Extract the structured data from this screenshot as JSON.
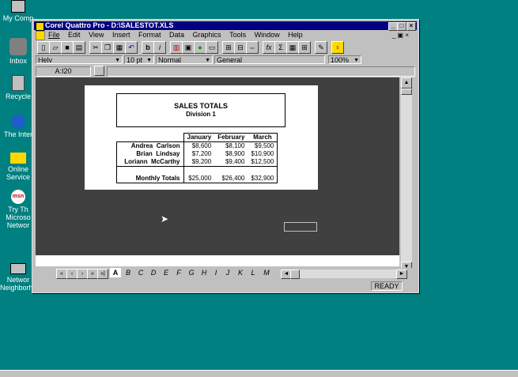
{
  "desktop": {
    "icons": [
      {
        "label": "My Comp"
      },
      {
        "label": "Inbox"
      },
      {
        "label": "Recycle"
      },
      {
        "label": "The Inter"
      },
      {
        "label": "Online Service"
      },
      {
        "label": "Try Th Microso Networ"
      },
      {
        "label": "Networ Neighborhood"
      }
    ]
  },
  "window": {
    "title": "Corel Quattro Pro - D:\\SALESTOT.XLS",
    "menu": [
      "File",
      "Edit",
      "View",
      "Insert",
      "Format",
      "Data",
      "Graphics",
      "Tools",
      "Window",
      "Help"
    ],
    "font": "Helv",
    "size": "10 pt",
    "style": "Normal",
    "number_format": "General",
    "zoom": "100%",
    "cell_ref": "A:I20",
    "status": "READY"
  },
  "report": {
    "title": "SALES TOTALS",
    "subtitle": "Division 1",
    "headers": [
      "January",
      "February",
      "March"
    ],
    "rows": [
      {
        "first": "Andrea",
        "last": "Carlson",
        "values": [
          "$8,600",
          "$8,100",
          "$9,500"
        ]
      },
      {
        "first": "Brian",
        "last": "Lindsay",
        "values": [
          "$7,200",
          "$8,900",
          "$10,900"
        ]
      },
      {
        "first": "Loriann",
        "last": "McCarthy",
        "values": [
          "$9,200",
          "$9,400",
          "$12,500"
        ]
      }
    ],
    "totals_label": "Monthly Totals",
    "totals": [
      "$25,000",
      "$26,400",
      "$32,900"
    ]
  },
  "sheet_tabs": [
    "A",
    "B",
    "C",
    "D",
    "E",
    "F",
    "G",
    "H",
    "I",
    "J",
    "K",
    "L",
    "M"
  ]
}
